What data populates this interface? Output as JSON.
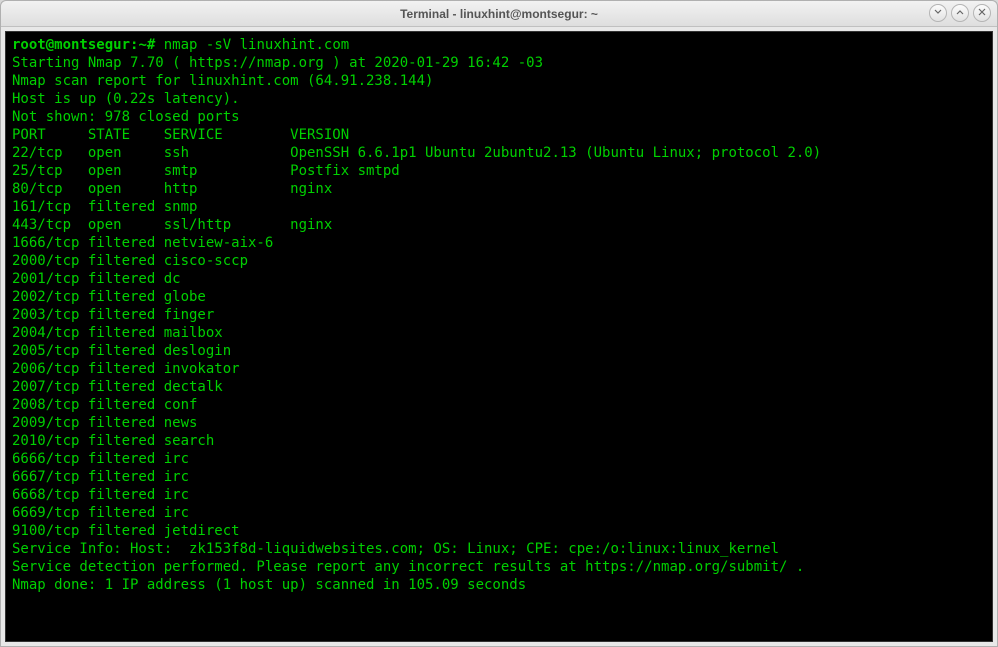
{
  "window": {
    "title": "Terminal - linuxhint@montsegur: ~"
  },
  "prompt": {
    "user_host": "root@montsegur",
    "sep": ":",
    "path": "~",
    "tail": "# "
  },
  "command": "nmap -sV linuxhint.com",
  "pre_lines": [
    "Starting Nmap 7.70 ( https://nmap.org ) at 2020-01-29 16:42 -03",
    "Nmap scan report for linuxhint.com (64.91.238.144)",
    "Host is up (0.22s latency).",
    "Not shown: 978 closed ports"
  ],
  "header": {
    "port": "PORT",
    "state": "STATE",
    "service": "SERVICE",
    "version": "VERSION"
  },
  "ports": [
    {
      "port": "22/tcp",
      "state": "open",
      "service": "ssh",
      "version": "OpenSSH 6.6.1p1 Ubuntu 2ubuntu2.13 (Ubuntu Linux; protocol 2.0)"
    },
    {
      "port": "25/tcp",
      "state": "open",
      "service": "smtp",
      "version": "Postfix smtpd"
    },
    {
      "port": "80/tcp",
      "state": "open",
      "service": "http",
      "version": "nginx"
    },
    {
      "port": "161/tcp",
      "state": "filtered",
      "service": "snmp",
      "version": ""
    },
    {
      "port": "443/tcp",
      "state": "open",
      "service": "ssl/http",
      "version": "nginx"
    },
    {
      "port": "1666/tcp",
      "state": "filtered",
      "service": "netview-aix-6",
      "version": ""
    },
    {
      "port": "2000/tcp",
      "state": "filtered",
      "service": "cisco-sccp",
      "version": ""
    },
    {
      "port": "2001/tcp",
      "state": "filtered",
      "service": "dc",
      "version": ""
    },
    {
      "port": "2002/tcp",
      "state": "filtered",
      "service": "globe",
      "version": ""
    },
    {
      "port": "2003/tcp",
      "state": "filtered",
      "service": "finger",
      "version": ""
    },
    {
      "port": "2004/tcp",
      "state": "filtered",
      "service": "mailbox",
      "version": ""
    },
    {
      "port": "2005/tcp",
      "state": "filtered",
      "service": "deslogin",
      "version": ""
    },
    {
      "port": "2006/tcp",
      "state": "filtered",
      "service": "invokator",
      "version": ""
    },
    {
      "port": "2007/tcp",
      "state": "filtered",
      "service": "dectalk",
      "version": ""
    },
    {
      "port": "2008/tcp",
      "state": "filtered",
      "service": "conf",
      "version": ""
    },
    {
      "port": "2009/tcp",
      "state": "filtered",
      "service": "news",
      "version": ""
    },
    {
      "port": "2010/tcp",
      "state": "filtered",
      "service": "search",
      "version": ""
    },
    {
      "port": "6666/tcp",
      "state": "filtered",
      "service": "irc",
      "version": ""
    },
    {
      "port": "6667/tcp",
      "state": "filtered",
      "service": "irc",
      "version": ""
    },
    {
      "port": "6668/tcp",
      "state": "filtered",
      "service": "irc",
      "version": ""
    },
    {
      "port": "6669/tcp",
      "state": "filtered",
      "service": "irc",
      "version": ""
    },
    {
      "port": "9100/tcp",
      "state": "filtered",
      "service": "jetdirect",
      "version": ""
    }
  ],
  "post_lines": [
    "Service Info: Host:  zk153f8d-liquidwebsites.com; OS: Linux; CPE: cpe:/o:linux:linux_kernel",
    "",
    "Service detection performed. Please report any incorrect results at https://nmap.org/submit/ .",
    "Nmap done: 1 IP address (1 host up) scanned in 105.09 seconds"
  ],
  "col_widths": {
    "port": 9,
    "state": 9,
    "service": 15
  }
}
